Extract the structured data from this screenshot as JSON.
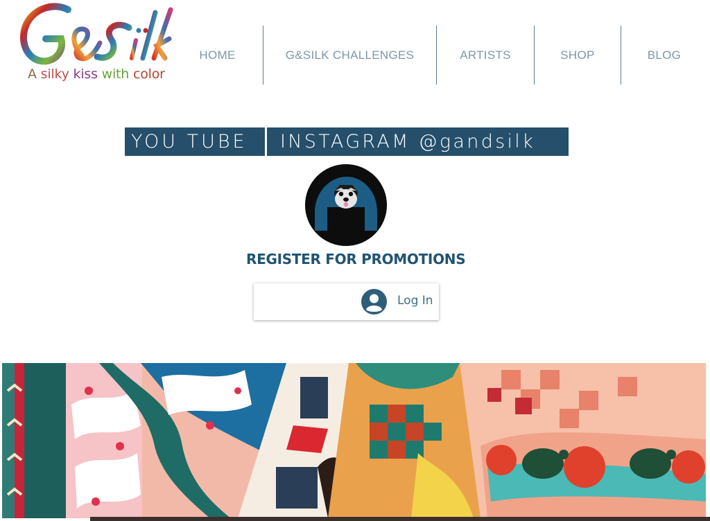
{
  "logo": {
    "wordmark": "G&Silk",
    "tagline": "A silky kiss with color"
  },
  "nav": {
    "items": [
      {
        "label": "HOME"
      },
      {
        "label": "G&SILK CHALLENGES"
      },
      {
        "label": "ARTISTS"
      },
      {
        "label": "SHOP"
      },
      {
        "label": "BLOG"
      }
    ]
  },
  "social": {
    "youtube_label": "YOU TUBE",
    "instagram_label": "INSTAGRAM @gandsilk"
  },
  "register_label": "REGISTER FOR PROMOTIONS",
  "login": {
    "label": "Log In"
  },
  "colors": {
    "brand_blue": "#254f6b",
    "nav_text": "#7e97a6",
    "register_text": "#1f5470"
  },
  "icons": [
    "schnauzer-avatar-icon",
    "user-avatar-icon"
  ]
}
